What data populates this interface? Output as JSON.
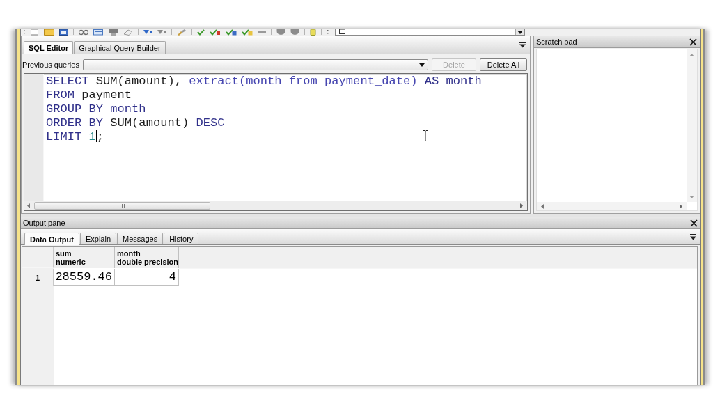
{
  "editor": {
    "tabs": [
      {
        "label": "SQL Editor",
        "selected": true
      },
      {
        "label": "Graphical Query Builder",
        "selected": false
      }
    ],
    "history": {
      "label": "Previous queries",
      "buttons": [
        {
          "label": "Delete",
          "disabled": true
        },
        {
          "label": "Delete All",
          "disabled": false
        }
      ]
    },
    "code": [
      [
        {
          "kind": "keyword",
          "text": "SELECT"
        },
        {
          "kind": "plain",
          "text": " SUM(amount), "
        },
        {
          "kind": "function",
          "text": "extract(month from payment_date)"
        },
        {
          "kind": "keyword",
          "text": " AS month"
        }
      ],
      [
        {
          "kind": "keyword",
          "text": "FROM"
        },
        {
          "kind": "plain",
          "text": " payment"
        }
      ],
      [
        {
          "kind": "keyword",
          "text": "GROUP BY month"
        }
      ],
      [
        {
          "kind": "keyword",
          "text": "ORDER BY"
        },
        {
          "kind": "plain",
          "text": " SUM(amount) "
        },
        {
          "kind": "keyword",
          "text": "DESC"
        }
      ],
      [
        {
          "kind": "keyword",
          "text": "LIMIT "
        },
        {
          "kind": "number",
          "text": "1"
        },
        {
          "kind": "caret"
        },
        {
          "kind": "plain",
          "text": ";"
        }
      ]
    ]
  },
  "scratch_pad": {
    "title": "Scratch pad"
  },
  "output_pane": {
    "title": "Output pane",
    "tabs": [
      {
        "label": "Data Output",
        "selected": true
      },
      {
        "label": "Explain",
        "selected": false
      },
      {
        "label": "Messages",
        "selected": false
      },
      {
        "label": "History",
        "selected": false
      }
    ],
    "grid": {
      "columns": [
        {
          "name": "sum",
          "type": "numeric"
        },
        {
          "name": "month",
          "type": "double precision"
        }
      ],
      "rows": [
        {
          "label": "1",
          "cells": [
            "28559.46",
            "4"
          ]
        }
      ]
    }
  }
}
